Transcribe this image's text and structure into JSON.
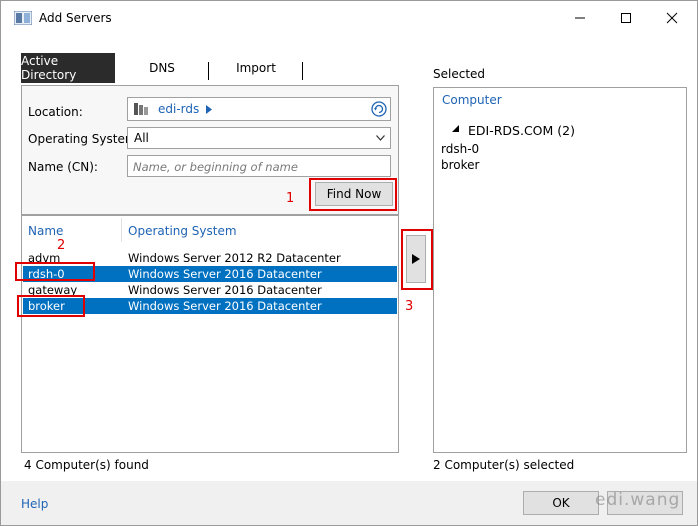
{
  "window": {
    "title": "Add Servers"
  },
  "tabs": [
    {
      "label": "Active Directory",
      "active": true
    },
    {
      "label": "DNS",
      "active": false
    },
    {
      "label": "Import",
      "active": false
    }
  ],
  "form": {
    "location_label": "Location:",
    "location_value": "edi-rds",
    "os_label": "Operating System:",
    "os_value": "All",
    "name_label": "Name (CN):",
    "name_placeholder": "Name, or beginning of name",
    "find_now": "Find Now"
  },
  "results": {
    "col_name": "Name",
    "col_os": "Operating System",
    "rows": [
      {
        "name": "advm",
        "os": "Windows Server 2012 R2 Datacenter",
        "selected": false
      },
      {
        "name": "rdsh-0",
        "os": "Windows Server 2016 Datacenter",
        "selected": true
      },
      {
        "name": "gateway",
        "os": "Windows Server 2016 Datacenter",
        "selected": false
      },
      {
        "name": "broker",
        "os": "Windows Server 2016 Datacenter",
        "selected": true
      }
    ],
    "status": "4 Computer(s) found"
  },
  "selected": {
    "label": "Selected",
    "col_computer": "Computer",
    "group": "EDI-RDS.COM (2)",
    "items": [
      "rdsh-0",
      "broker"
    ],
    "status": "2 Computer(s) selected"
  },
  "annotations": {
    "n1": "1",
    "n2": "2",
    "n3": "3"
  },
  "footer": {
    "help": "Help",
    "ok": "OK",
    "watermark": "edi.wang"
  },
  "colors": {
    "selection": "#0070c0",
    "annotation": "#e00000",
    "link": "#1e63b4",
    "active_tab": "#2b2b2b"
  }
}
